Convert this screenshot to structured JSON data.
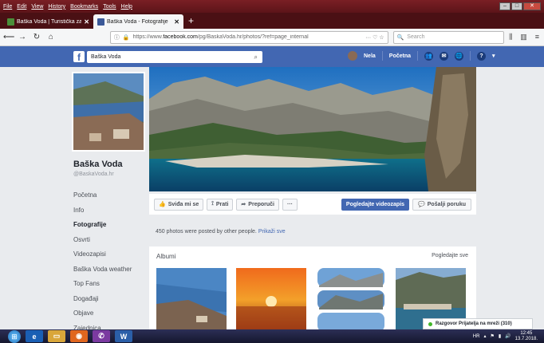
{
  "browser": {
    "menu": [
      "File",
      "Edit",
      "View",
      "History",
      "Bookmarks",
      "Tools",
      "Help"
    ],
    "tabs": [
      {
        "title": "Baška Voda | Turistička zajedn"
      },
      {
        "title": "Baška Voda - Fotografije"
      }
    ],
    "new_tab": "+",
    "url_prefix": "https://www.",
    "url_domain": "facebook.com",
    "url_rest": "/pg/BaskaVoda.hr/photos/?ref=page_internal",
    "url_actions": "··· ♡ ☆",
    "search_placeholder": "Search"
  },
  "fb": {
    "search_value": "Baška Voda",
    "user_name": "Nela",
    "home_label": "Početna"
  },
  "page": {
    "name": "Baška Voda",
    "handle": "@BaskaVoda.hr",
    "nav": [
      "Početna",
      "Info",
      "Fotografije",
      "Osvrti",
      "Videozapisi",
      "Baška Voda weather",
      "Top Fans",
      "Događaji",
      "Objave",
      "Zajednica"
    ],
    "active_nav": "Fotografije"
  },
  "actions": {
    "like": "Sviđa mi se",
    "follow": "Prati",
    "share": "Preporuči",
    "more": "···",
    "watch": "Pogledajte videozapis",
    "message": "Pošalji poruku"
  },
  "photos": {
    "posted_text": "450 photos were posted by other people.",
    "show_link": "Prikaži sve",
    "albums_title": "Albumi",
    "see_all": "Pogledajte sve"
  },
  "chat": {
    "label": "Razgovor Prijatelja na mreži (310)"
  },
  "taskbar": {
    "lang": "HR",
    "time": "12:45",
    "date": "13.7.2018."
  }
}
